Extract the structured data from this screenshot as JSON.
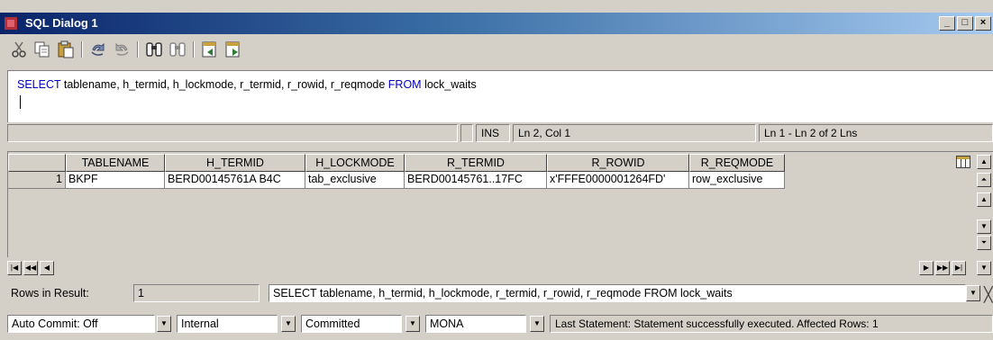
{
  "window": {
    "title": "SQL Dialog 1",
    "minimize": "_",
    "maximize": "□",
    "close": "×"
  },
  "toolbar": {
    "icons": [
      "cut-icon",
      "copy-icon",
      "paste-icon",
      "undo-icon",
      "redo-icon",
      "find-icon",
      "replace-icon",
      "export-icon",
      "import-icon"
    ]
  },
  "editor": {
    "kw_select": "SELECT",
    "columns_text": " tablename, h_termid, h_lockmode, r_termid, r_rowid, r_reqmode ",
    "kw_from": "FROM",
    "table_text": " lock_waits"
  },
  "status": {
    "mode": "INS",
    "cursor": "Ln 2, Col 1",
    "range": "Ln 1 - Ln 2 of 2 Lns"
  },
  "grid": {
    "columns": [
      "TABLENAME",
      "H_TERMID",
      "H_LOCKMODE",
      "R_TERMID",
      "R_ROWID",
      "R_REQMODE"
    ],
    "rows": [
      {
        "num": "1",
        "cells": [
          "BKPF",
          "BERD00145761A B4C",
          "tab_exclusive",
          "BERD00145761..17FC",
          "x'FFFE0000001264FD'",
          "row_exclusive"
        ]
      }
    ]
  },
  "result": {
    "rows_label": "Rows in Result:",
    "rows_value": "1",
    "history_value": "SELECT tablename, h_termid, h_lockmode, r_termid, r_rowid, r_reqmode FROM lock_waits"
  },
  "bottom": {
    "autocommit": "Auto Commit: Off",
    "mode": "Internal",
    "isolation": "Committed",
    "database": "MONA",
    "message": "Last Statement: Statement successfully executed. Affected Rows:  1"
  },
  "colors": {
    "keyword": "#0000c0",
    "title_bar": "#0a246a",
    "face": "#d4d0c8"
  }
}
